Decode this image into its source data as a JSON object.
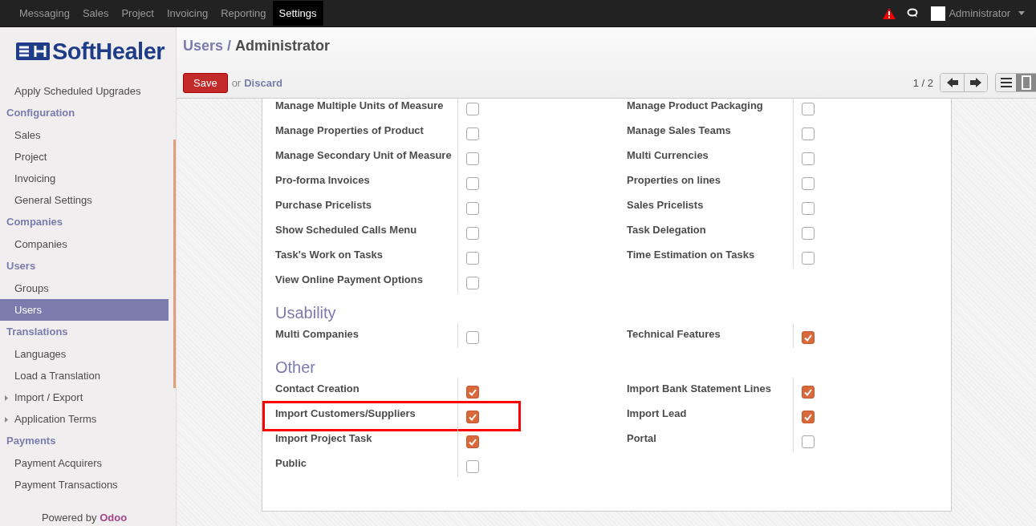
{
  "topbar": {
    "menu": [
      {
        "label": "Messaging",
        "selected": false
      },
      {
        "label": "Sales",
        "selected": false
      },
      {
        "label": "Project",
        "selected": false
      },
      {
        "label": "Invoicing",
        "selected": false
      },
      {
        "label": "Reporting",
        "selected": false
      },
      {
        "label": "Settings",
        "selected": true
      }
    ],
    "user": "Administrator"
  },
  "sidebar": {
    "logo": "SoftHealer",
    "items": [
      {
        "kind": "item",
        "label": "Apply Scheduled Upgrades",
        "selected": false,
        "expandable": false
      },
      {
        "kind": "header",
        "label": "Configuration"
      },
      {
        "kind": "item",
        "label": "Sales",
        "selected": false,
        "expandable": false
      },
      {
        "kind": "item",
        "label": "Project",
        "selected": false,
        "expandable": false
      },
      {
        "kind": "item",
        "label": "Invoicing",
        "selected": false,
        "expandable": false
      },
      {
        "kind": "item",
        "label": "General Settings",
        "selected": false,
        "expandable": false
      },
      {
        "kind": "header",
        "label": "Companies"
      },
      {
        "kind": "item",
        "label": "Companies",
        "selected": false,
        "expandable": false
      },
      {
        "kind": "header",
        "label": "Users"
      },
      {
        "kind": "item",
        "label": "Groups",
        "selected": false,
        "expandable": false
      },
      {
        "kind": "item",
        "label": "Users",
        "selected": true,
        "expandable": false
      },
      {
        "kind": "header",
        "label": "Translations"
      },
      {
        "kind": "item",
        "label": "Languages",
        "selected": false,
        "expandable": false
      },
      {
        "kind": "item",
        "label": "Load a Translation",
        "selected": false,
        "expandable": false
      },
      {
        "kind": "item",
        "label": "Import / Export",
        "selected": false,
        "expandable": true
      },
      {
        "kind": "item",
        "label": "Application Terms",
        "selected": false,
        "expandable": true
      },
      {
        "kind": "header",
        "label": "Payments"
      },
      {
        "kind": "item",
        "label": "Payment Acquirers",
        "selected": false,
        "expandable": false
      },
      {
        "kind": "item",
        "label": "Payment Transactions",
        "selected": false,
        "expandable": false
      }
    ],
    "footer_text": "Powered by",
    "footer_link": "Odoo"
  },
  "breadcrumb": {
    "parent": "Users",
    "separator": "/",
    "current": "Administrator"
  },
  "actions": {
    "save": "Save",
    "or": "or",
    "discard": "Discard"
  },
  "pager": "1 / 2",
  "sections": [
    {
      "fields": [
        {
          "label": "Manage Multiple Units of Measure",
          "checked": false,
          "highlighted": false
        },
        {
          "label": "Manage Product Packaging",
          "checked": false,
          "highlighted": false
        },
        {
          "label": "Manage Properties of Product",
          "checked": false,
          "highlighted": false
        },
        {
          "label": "Manage Sales Teams",
          "checked": false,
          "highlighted": false
        },
        {
          "label": "Manage Secondary Unit of Measure",
          "checked": false,
          "highlighted": false
        },
        {
          "label": "Multi Currencies",
          "checked": false,
          "highlighted": false
        },
        {
          "label": "Pro-forma Invoices",
          "checked": false,
          "highlighted": false
        },
        {
          "label": "Properties on lines",
          "checked": false,
          "highlighted": false
        },
        {
          "label": "Purchase Pricelists",
          "checked": false,
          "highlighted": false
        },
        {
          "label": "Sales Pricelists",
          "checked": false,
          "highlighted": false
        },
        {
          "label": "Show Scheduled Calls Menu",
          "checked": false,
          "highlighted": false
        },
        {
          "label": "Task Delegation",
          "checked": false,
          "highlighted": false
        },
        {
          "label": "Task's Work on Tasks",
          "checked": false,
          "highlighted": false
        },
        {
          "label": "Time Estimation on Tasks",
          "checked": false,
          "highlighted": false
        },
        {
          "label": "View Online Payment Options",
          "checked": false,
          "highlighted": false
        }
      ]
    },
    {
      "title": "Usability",
      "fields": [
        {
          "label": "Multi Companies",
          "checked": false,
          "highlighted": false
        },
        {
          "label": "Technical Features",
          "checked": true,
          "highlighted": false
        }
      ]
    },
    {
      "title": "Other",
      "fields": [
        {
          "label": "Contact Creation",
          "checked": true,
          "highlighted": false
        },
        {
          "label": "Import Bank Statement Lines",
          "checked": true,
          "highlighted": false
        },
        {
          "label": "Import Customers/Suppliers",
          "checked": true,
          "highlighted": true
        },
        {
          "label": "Import Lead",
          "checked": true,
          "highlighted": false
        },
        {
          "label": "Import Project Task",
          "checked": true,
          "highlighted": false
        },
        {
          "label": "Portal",
          "checked": false,
          "highlighted": false
        },
        {
          "label": "Public",
          "checked": false,
          "highlighted": false
        }
      ]
    }
  ]
}
